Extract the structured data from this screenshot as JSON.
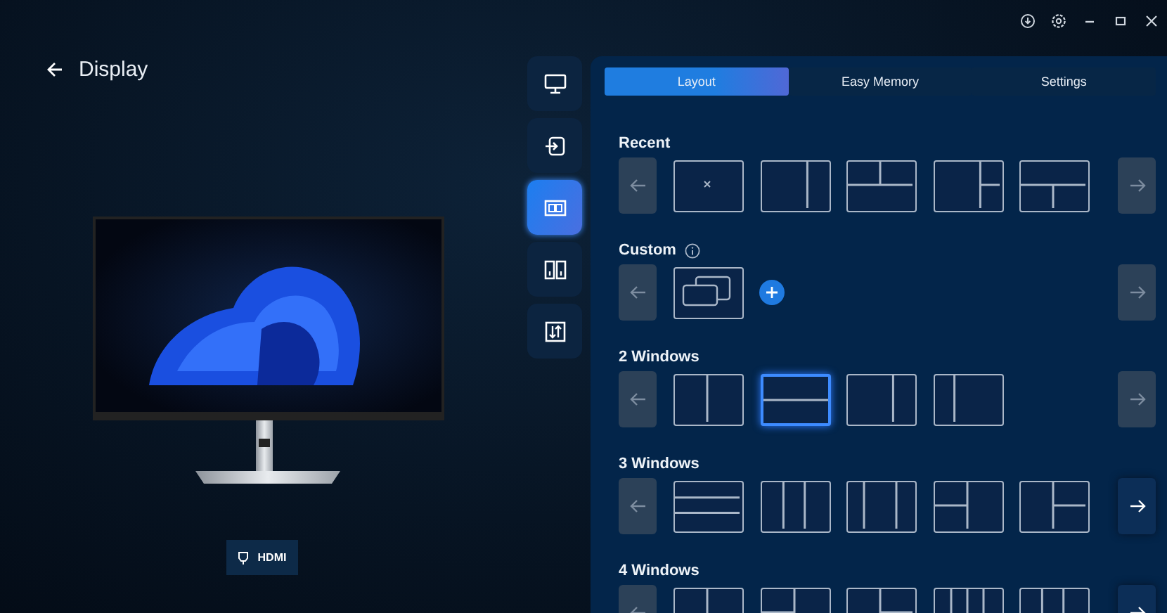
{
  "header": {
    "title": "Display"
  },
  "input_badge": {
    "label": "HDMI"
  },
  "nav": [
    {
      "kind": "monitor",
      "selected": false
    },
    {
      "kind": "input",
      "selected": false
    },
    {
      "kind": "layout",
      "selected": true
    },
    {
      "kind": "split",
      "selected": false
    },
    {
      "kind": "arrange",
      "selected": false
    }
  ],
  "tabs": [
    {
      "label": "Layout",
      "selected": true
    },
    {
      "label": "Easy Memory",
      "selected": false
    },
    {
      "label": "Settings",
      "selected": false
    }
  ],
  "sections": [
    {
      "title": "Recent",
      "prev_disabled": true,
      "next_disabled": true,
      "layouts": [
        {
          "kind": "empty",
          "selected": false
        },
        {
          "kind": "v70",
          "selected": false
        },
        {
          "kind": "top-split",
          "selected": false
        },
        {
          "kind": "right-split70",
          "selected": false
        },
        {
          "kind": "bottom-split",
          "selected": false
        }
      ]
    },
    {
      "title": "Custom",
      "info": true,
      "add": true,
      "prev_disabled": true,
      "next_disabled": true,
      "layouts": [
        {
          "kind": "overlap",
          "selected": false
        }
      ]
    },
    {
      "title": "2 Windows",
      "prev_disabled": true,
      "next_disabled": true,
      "layouts": [
        {
          "kind": "v50",
          "selected": false
        },
        {
          "kind": "h50",
          "selected": true
        },
        {
          "kind": "v70",
          "selected": false
        },
        {
          "kind": "v30",
          "selected": false
        }
      ]
    },
    {
      "title": "3 Windows",
      "prev_disabled": true,
      "next_disabled": false,
      "layouts": [
        {
          "kind": "h-thirds",
          "selected": false
        },
        {
          "kind": "v-thirds",
          "selected": false
        },
        {
          "kind": "v-wide-mid",
          "selected": false
        },
        {
          "kind": "left-split",
          "selected": false
        },
        {
          "kind": "right-split",
          "selected": false
        }
      ]
    },
    {
      "title": "4 Windows",
      "prev_disabled": true,
      "next_disabled": false,
      "layouts": [
        {
          "kind": "v50",
          "selected": false
        },
        {
          "kind": "left-split",
          "selected": false
        },
        {
          "kind": "right-split",
          "selected": false
        },
        {
          "kind": "v-quarters",
          "selected": false
        },
        {
          "kind": "v-thirds",
          "selected": false
        }
      ]
    }
  ]
}
